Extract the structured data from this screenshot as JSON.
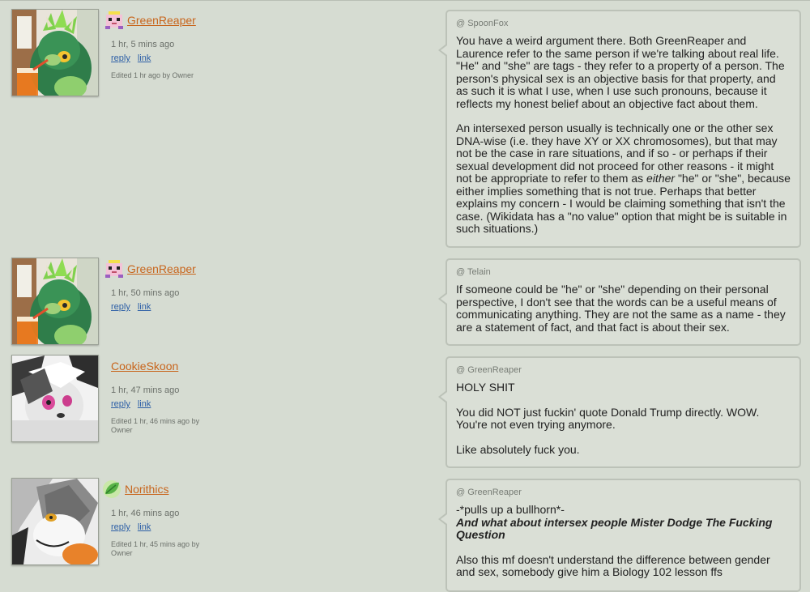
{
  "comments": [
    {
      "username": "GreenReaper",
      "time": "1 hr, 5 mins ago",
      "reply": "reply",
      "link": "link",
      "edited": "Edited 1 hr ago by Owner",
      "at": "@ SpoonFox",
      "p1": "You have a weird argument there. Both GreenReaper and Laurence refer to the same person if we're talking about real life. \"He\" and \"she\" are tags - they refer to a property of a person. The person's physical sex is an objective basis for that property, and as such it is what I use, when I use such pronouns, because it reflects my honest belief about an objective fact about them.",
      "p2a": "An intersexed person usually is technically one or the other sex DNA-wise (i.e. they have XY or XX chromosomes), but that may not be the case in rare situations, and if so - or perhaps if their sexual development did not proceed for other reasons - it might not be appropriate to refer to them as ",
      "p2em": "either",
      "p2b": " \"he\" or \"she\", because either implies something that is not true. Perhaps that better explains my concern - I would be claiming something that isn't the case. (Wikidata has a \"no value\" option that might be is suitable in such situations.)"
    },
    {
      "username": "GreenReaper",
      "time": "1 hr, 50 mins ago",
      "reply": "reply",
      "link": "link",
      "at": "@ Telain",
      "p1": "If someone could be \"he\" or \"she\" depending on their personal perspective, I don't see that the words can be a useful means of communicating anything. They are not the same as a name - they are a statement of fact, and that fact is about their sex."
    },
    {
      "username": "CookieSkoon",
      "time": "1 hr, 47 mins ago",
      "reply": "reply",
      "link": "link",
      "edited": "Edited 1 hr, 46 mins ago by Owner",
      "at": "@ GreenReaper",
      "p1": "HOLY SHIT",
      "p2": "You did NOT just fuckin' quote Donald Trump directly. WOW. You're not even trying anymore.",
      "p3": "Like absolutely fuck you."
    },
    {
      "username": "Norithics",
      "time": "1 hr, 46 mins ago",
      "reply": "reply",
      "link": "link",
      "edited": "Edited 1 hr, 45 mins ago by Owner",
      "at": "@ GreenReaper",
      "p1": "-*pulls up a bullhorn*-",
      "p1b": "And what about intersex people Mister Dodge The Fucking Question",
      "p2": "Also this mf doesn't understand the difference between gender and sex, somebody give him a Biology 102 lesson ffs"
    }
  ]
}
